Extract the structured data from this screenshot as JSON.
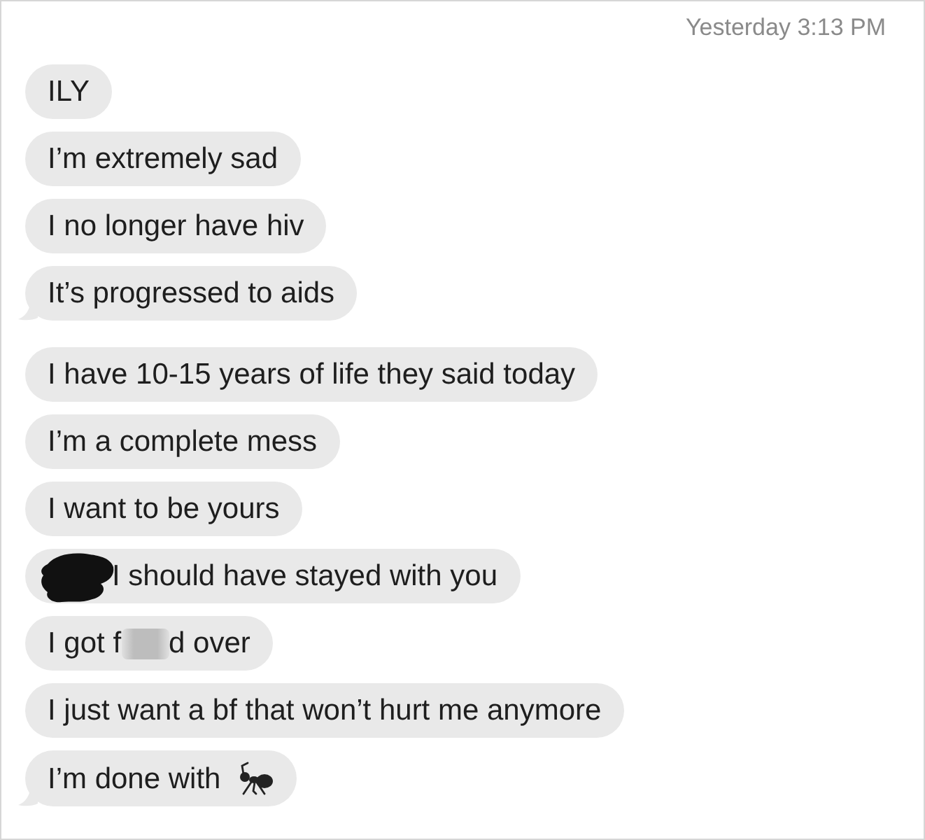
{
  "timestamp": "Yesterday 3:13 PM",
  "groups": [
    {
      "messages": [
        {
          "parts": [
            {
              "kind": "text",
              "text": "ILY"
            }
          ]
        },
        {
          "parts": [
            {
              "kind": "text",
              "text": "I’m extremely sad"
            }
          ]
        },
        {
          "parts": [
            {
              "kind": "text",
              "text": "I no longer have hiv"
            }
          ]
        },
        {
          "parts": [
            {
              "kind": "text",
              "text": "It’s progressed to aids"
            }
          ]
        }
      ]
    },
    {
      "messages": [
        {
          "parts": [
            {
              "kind": "text",
              "text": "I have 10-15 years of life they said today"
            }
          ]
        },
        {
          "parts": [
            {
              "kind": "text",
              "text": "I’m a complete mess"
            }
          ]
        },
        {
          "parts": [
            {
              "kind": "text",
              "text": "I want to be yours"
            }
          ]
        },
        {
          "parts": [
            {
              "kind": "scribble"
            },
            {
              "kind": "text",
              "text": "I should have stayed with you"
            }
          ]
        },
        {
          "parts": [
            {
              "kind": "text",
              "text": "I got f"
            },
            {
              "kind": "blur"
            },
            {
              "kind": "text",
              "text": "d over"
            }
          ]
        },
        {
          "parts": [
            {
              "kind": "text",
              "text": "I just want a bf that won’t hurt me anymore"
            }
          ]
        },
        {
          "parts": [
            {
              "kind": "text",
              "text": "I’m done with "
            },
            {
              "kind": "icon"
            }
          ]
        }
      ]
    }
  ]
}
